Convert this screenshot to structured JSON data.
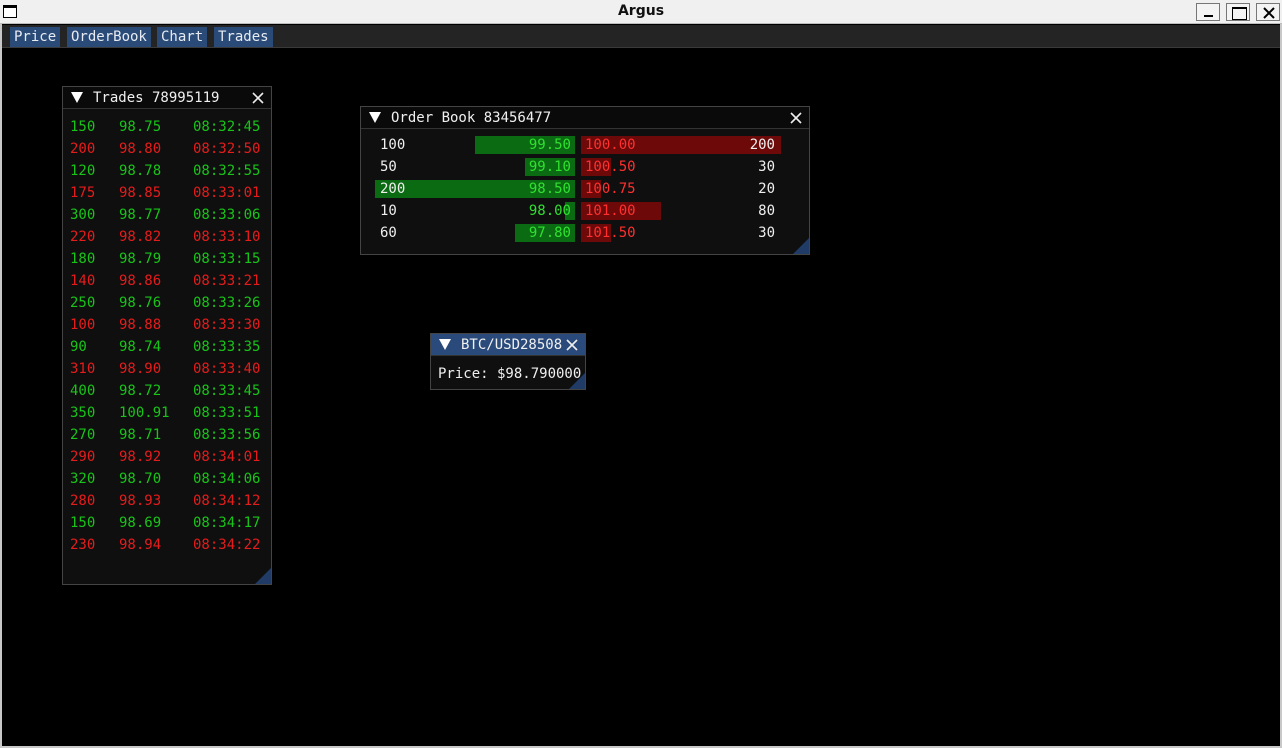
{
  "window": {
    "title": "Argus"
  },
  "menu": [
    {
      "label": "Price"
    },
    {
      "label": "OrderBook"
    },
    {
      "label": "Chart"
    },
    {
      "label": "Trades"
    }
  ],
  "trades_panel": {
    "title": "Trades 78995119",
    "rows": [
      {
        "qty": "150",
        "price": "98.75",
        "time": "08:32:45",
        "side": "buy"
      },
      {
        "qty": "200",
        "price": "98.80",
        "time": "08:32:50",
        "side": "sell"
      },
      {
        "qty": "120",
        "price": "98.78",
        "time": "08:32:55",
        "side": "buy"
      },
      {
        "qty": "175",
        "price": "98.85",
        "time": "08:33:01",
        "side": "sell"
      },
      {
        "qty": "300",
        "price": "98.77",
        "time": "08:33:06",
        "side": "buy"
      },
      {
        "qty": "220",
        "price": "98.82",
        "time": "08:33:10",
        "side": "sell"
      },
      {
        "qty": "180",
        "price": "98.79",
        "time": "08:33:15",
        "side": "buy"
      },
      {
        "qty": "140",
        "price": "98.86",
        "time": "08:33:21",
        "side": "sell"
      },
      {
        "qty": "250",
        "price": "98.76",
        "time": "08:33:26",
        "side": "buy"
      },
      {
        "qty": "100",
        "price": "98.88",
        "time": "08:33:30",
        "side": "sell"
      },
      {
        "qty": "90",
        "price": "98.74",
        "time": "08:33:35",
        "side": "buy"
      },
      {
        "qty": "310",
        "price": "98.90",
        "time": "08:33:40",
        "side": "sell"
      },
      {
        "qty": "400",
        "price": "98.72",
        "time": "08:33:45",
        "side": "buy"
      },
      {
        "qty": "350",
        "price": "100.91",
        "time": "08:33:51",
        "side": "buy"
      },
      {
        "qty": "270",
        "price": "98.71",
        "time": "08:33:56",
        "side": "buy"
      },
      {
        "qty": "290",
        "price": "98.92",
        "time": "08:34:01",
        "side": "sell"
      },
      {
        "qty": "320",
        "price": "98.70",
        "time": "08:34:06",
        "side": "buy"
      },
      {
        "qty": "280",
        "price": "98.93",
        "time": "08:34:12",
        "side": "sell"
      },
      {
        "qty": "150",
        "price": "98.69",
        "time": "08:34:17",
        "side": "buy"
      },
      {
        "qty": "230",
        "price": "98.94",
        "time": "08:34:22",
        "side": "sell"
      }
    ]
  },
  "orderbook_panel": {
    "title": "Order Book 83456477",
    "rows": [
      {
        "bid_qty": "100",
        "bid_price": "99.50",
        "ask_price": "100.00",
        "ask_qty": "200",
        "bid_fill": 0.5,
        "ask_fill": 1.0
      },
      {
        "bid_qty": "50",
        "bid_price": "99.10",
        "ask_price": "100.50",
        "ask_qty": "30",
        "bid_fill": 0.25,
        "ask_fill": 0.15
      },
      {
        "bid_qty": "200",
        "bid_price": "98.50",
        "ask_price": "100.75",
        "ask_qty": "20",
        "bid_fill": 1.0,
        "ask_fill": 0.1
      },
      {
        "bid_qty": "10",
        "bid_price": "98.00",
        "ask_price": "101.00",
        "ask_qty": "80",
        "bid_fill": 0.05,
        "ask_fill": 0.4
      },
      {
        "bid_qty": "60",
        "bid_price": "97.80",
        "ask_price": "101.50",
        "ask_qty": "30",
        "bid_fill": 0.3,
        "ask_fill": 0.15
      }
    ]
  },
  "price_panel": {
    "title": "BTC/USD28508",
    "price_text": "Price: $98.790000"
  },
  "colors": {
    "buy": "#18c418",
    "sell": "#e51c1c",
    "bid_bar": "#0b6b12",
    "ask_bar": "#6d0909",
    "accent": "#294a7a"
  }
}
